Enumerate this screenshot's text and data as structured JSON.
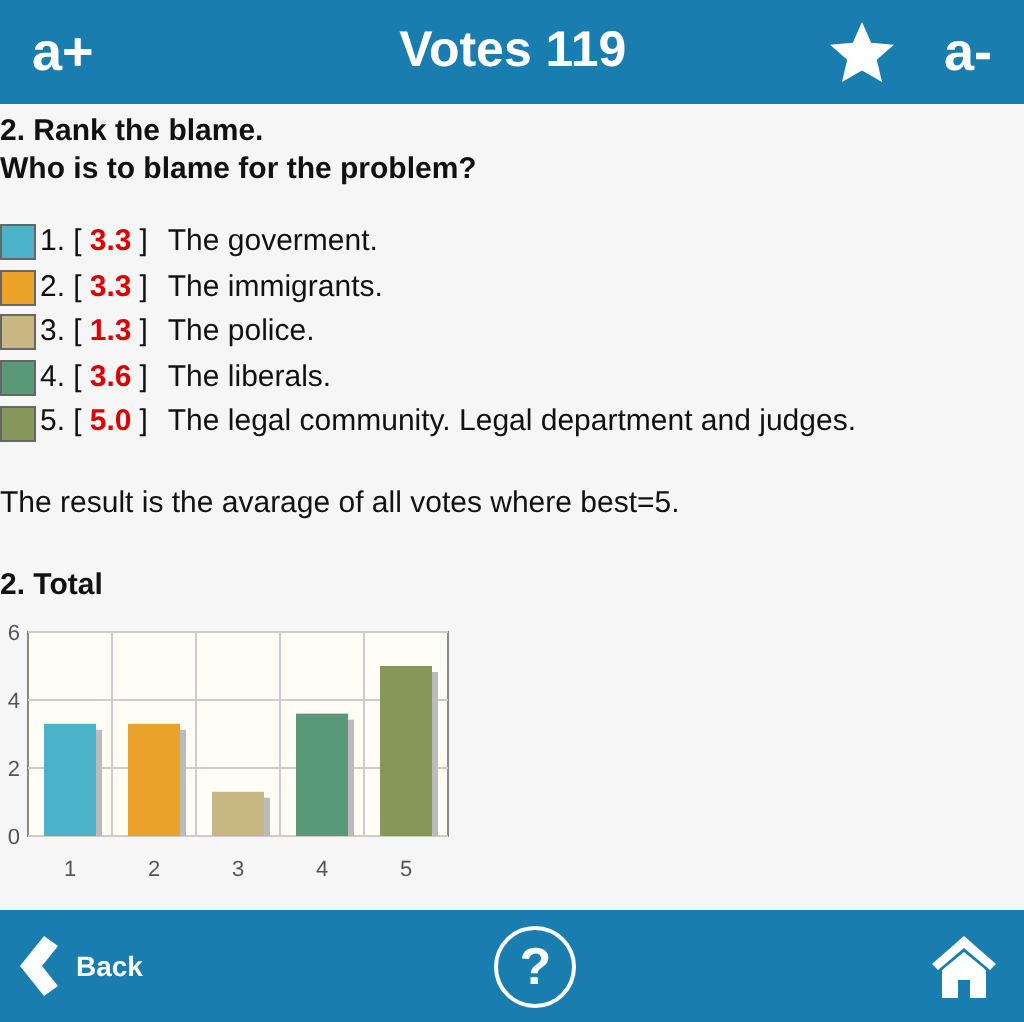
{
  "header": {
    "left_button": "a+",
    "title": "Votes 119",
    "right_button": "a-"
  },
  "question": {
    "title": "2. Rank the blame.",
    "subtitle": "Who is to blame for the problem?"
  },
  "items": [
    {
      "rank": "1. [",
      "score": "3.3",
      "close": "]",
      "label": "The goverment.",
      "color": "#4ab3c9"
    },
    {
      "rank": "2. [",
      "score": "3.3",
      "close": "]",
      "label": "The immigrants.",
      "color": "#eaa22a"
    },
    {
      "rank": "3. [",
      "score": "1.3",
      "close": "]",
      "label": "The police.",
      "color": "#c8b783"
    },
    {
      "rank": "4. [",
      "score": "3.6",
      "close": "]",
      "label": "The liberals.",
      "color": "#5a9978"
    },
    {
      "rank": "5. [",
      "score": "5.0",
      "close": "]",
      "label": "The legal community. Legal department and judges.",
      "color": "#87975a"
    }
  ],
  "note": "The result is the avarage of all votes where best=5.",
  "total": {
    "title": "2. Total",
    "chart_data": {
      "type": "bar",
      "categories": [
        "1",
        "2",
        "3",
        "4",
        "5"
      ],
      "values": [
        3.3,
        3.3,
        1.3,
        3.6,
        5.0
      ],
      "ylim": [
        0,
        6
      ],
      "yticks": [
        0,
        2,
        4,
        6
      ]
    }
  },
  "footer": {
    "back": "Back",
    "help": "?"
  }
}
